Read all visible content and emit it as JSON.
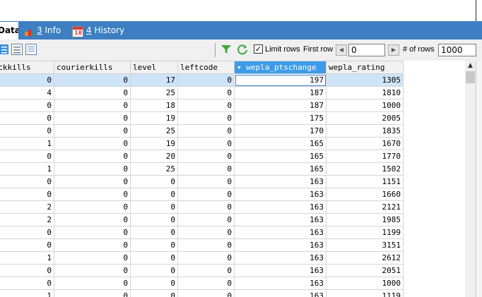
{
  "tabs": [
    {
      "label": "Data",
      "active": true
    },
    {
      "num": "3",
      "text": "Info",
      "icon": "info-icon"
    },
    {
      "num": "4",
      "text": "History",
      "icon": "history-icon",
      "icon_text": "18"
    }
  ],
  "toolbar": {
    "limit_rows_label": "Limit rows",
    "limit_rows_checked": true,
    "first_row_label": "First row",
    "first_row_value": "0",
    "num_rows_label": "# of rows",
    "num_rows_value": "1000"
  },
  "grid": {
    "columns": [
      "rackkills",
      "courierkills",
      "level",
      "leftcode",
      "wepla_ptschange",
      "wepla_rating"
    ],
    "sorted_column": "wepla_ptschange",
    "rows": [
      [
        "0",
        "0",
        "17",
        "0",
        "197",
        "1305"
      ],
      [
        "4",
        "0",
        "25",
        "0",
        "187",
        "1810"
      ],
      [
        "0",
        "0",
        "18",
        "0",
        "187",
        "1000"
      ],
      [
        "0",
        "0",
        "19",
        "0",
        "175",
        "2005"
      ],
      [
        "0",
        "0",
        "25",
        "0",
        "170",
        "1835"
      ],
      [
        "1",
        "0",
        "19",
        "0",
        "165",
        "1670"
      ],
      [
        "0",
        "0",
        "20",
        "0",
        "165",
        "1770"
      ],
      [
        "1",
        "0",
        "25",
        "0",
        "165",
        "1502"
      ],
      [
        "0",
        "0",
        "0",
        "0",
        "163",
        "1151"
      ],
      [
        "0",
        "0",
        "0",
        "0",
        "163",
        "1660"
      ],
      [
        "2",
        "0",
        "0",
        "0",
        "163",
        "2121"
      ],
      [
        "2",
        "0",
        "0",
        "0",
        "163",
        "1985"
      ],
      [
        "0",
        "0",
        "0",
        "0",
        "163",
        "1199"
      ],
      [
        "0",
        "0",
        "0",
        "0",
        "163",
        "3151"
      ],
      [
        "1",
        "0",
        "0",
        "0",
        "163",
        "2612"
      ],
      [
        "0",
        "0",
        "0",
        "0",
        "163",
        "2051"
      ],
      [
        "0",
        "0",
        "0",
        "0",
        "163",
        "1000"
      ],
      [
        "1",
        "0",
        "0",
        "0",
        "163",
        "1119"
      ]
    ]
  },
  "colors": {
    "tabbar": "#3d7fc2",
    "sorted_header": "#3d9be9",
    "selection": "#cde4f9"
  }
}
